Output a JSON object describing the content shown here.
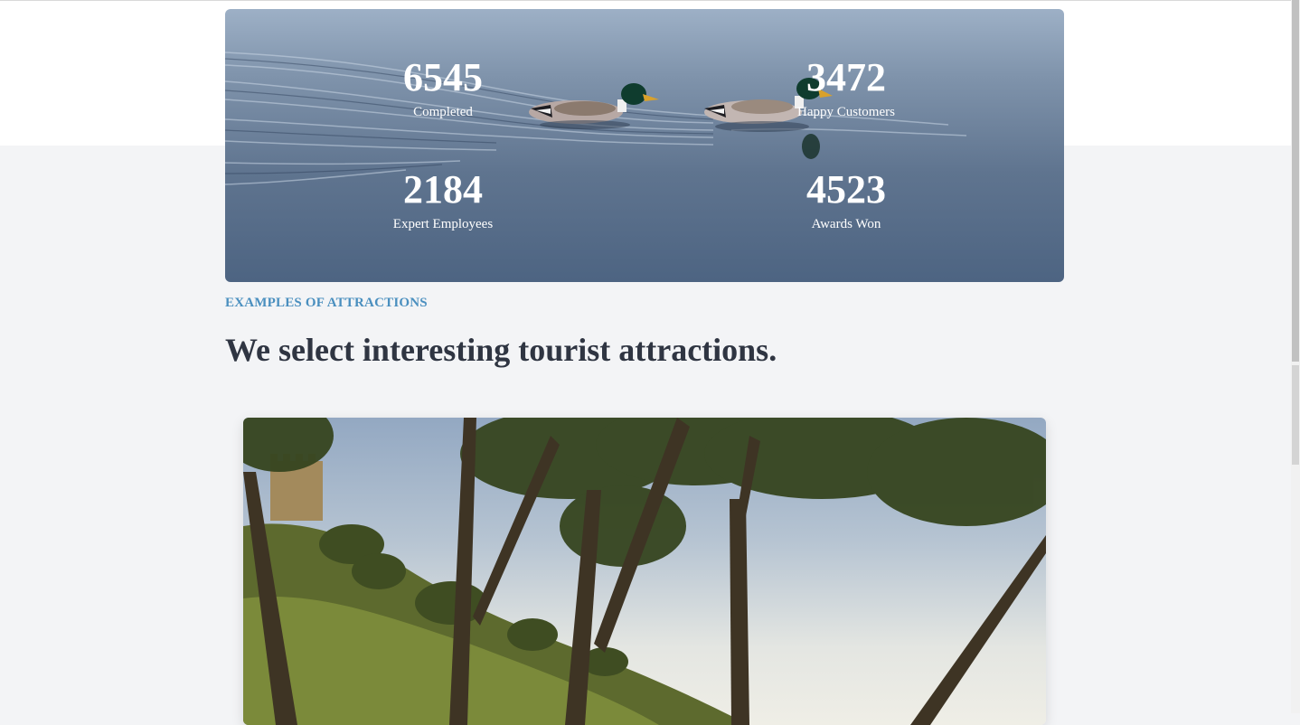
{
  "stats": [
    {
      "value": "6545",
      "label": "Completed"
    },
    {
      "value": "3472",
      "label": "Happy Customers"
    },
    {
      "value": "2184",
      "label": "Expert Employees"
    },
    {
      "value": "4523",
      "label": "Awards Won"
    }
  ],
  "attractions": {
    "eyebrow": "EXAMPLES OF ATTRACTIONS",
    "heading": "We select interesting tourist attractions."
  },
  "colors": {
    "eyebrow": "#4a8fbf",
    "heading": "#2f3542",
    "page_background": "#f3f4f6"
  }
}
